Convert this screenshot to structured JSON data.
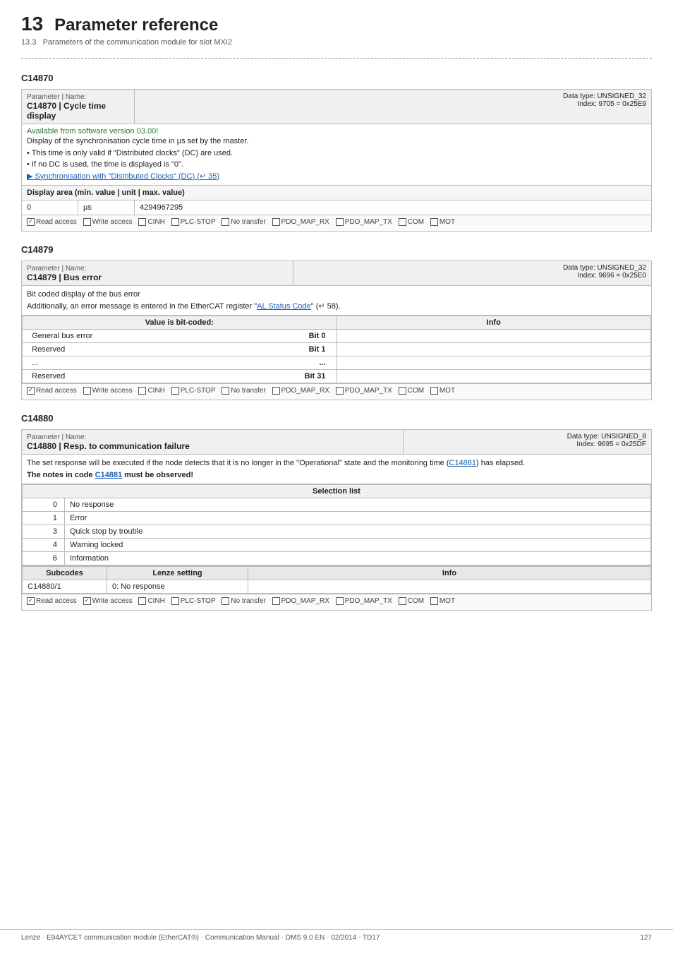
{
  "header": {
    "page_number": "13",
    "title": "Parameter reference",
    "sub_heading_number": "13.3",
    "sub_heading": "Parameters of the communication module for slot MXI2"
  },
  "divider": "_ _ _ _ _ _ _ _ _ _ _ _ _ _ _ _ _ _ _ _ _ _ _ _ _ _ _ _ _ _ _ _ _ _ _ _ _ _ _ _ _ _ _ _ _ _ _ _ _ _ _ _ _ _ _ _ _ _ _",
  "sections": [
    {
      "id": "C14870",
      "label": "C14870",
      "param_name": "C14870 | Cycle time display",
      "data_type": "Data type: UNSIGNED_32",
      "index": "Index: 9705 = 0x25E9",
      "available_note": "Available from software version 03.00!",
      "description_lines": [
        "Display of the synchronisation cycle time in µs set by the master.",
        "• This time is only valid if \"Distributed clocks\" (DC) are used.",
        "• If no DC is used, the time is displayed is \"0\".",
        "▶ Synchronisation with \"Distributed Clocks\" (DC) (↵ 35)"
      ],
      "display_area_label": "Display area (min. value | unit | max. value)",
      "display_area_min": "0",
      "display_area_unit": "µs",
      "display_area_max": "4294967295",
      "access": {
        "read_access": {
          "label": "Read access",
          "checked": true
        },
        "write_access": {
          "label": "Write access",
          "checked": false
        },
        "cinh": {
          "label": "CINH",
          "checked": false
        },
        "plc_stop": {
          "label": "PLC-STOP",
          "checked": false
        },
        "no_transfer": {
          "label": "No transfer",
          "checked": false
        },
        "pdo_map_rx": {
          "label": "PDO_MAP_RX",
          "checked": false
        },
        "pdo_map_tx": {
          "label": "PDO_MAP_TX",
          "checked": false
        },
        "com": {
          "label": "COM",
          "checked": false
        },
        "mot": {
          "label": "MOT",
          "checked": false
        }
      }
    },
    {
      "id": "C14879",
      "label": "C14879",
      "param_name": "C14879 | Bus error",
      "data_type": "Data type: UNSIGNED_32",
      "index": "Index: 9696 = 0x25E0",
      "description_lines": [
        "Bit coded display of the bus error",
        "Additionally, an error message is entered in the EtherCAT register \"AL Status Code\" (↵ 58)."
      ],
      "bit_coded_label": "Value is bit-coded:",
      "bit_info_label": "Info",
      "bits": [
        {
          "bit": "Bit 0",
          "desc": "General bus error",
          "info": ""
        },
        {
          "bit": "Bit 1",
          "desc": "Reserved",
          "info": ""
        },
        {
          "bit": "...",
          "desc": "...",
          "info": ""
        },
        {
          "bit": "Bit 31",
          "desc": "Reserved",
          "info": ""
        }
      ],
      "access": {
        "read_access": {
          "label": "Read access",
          "checked": true
        },
        "write_access": {
          "label": "Write access",
          "checked": false
        },
        "cinh": {
          "label": "CINH",
          "checked": false
        },
        "plc_stop": {
          "label": "PLC-STOP",
          "checked": false
        },
        "no_transfer": {
          "label": "No transfer",
          "checked": false
        },
        "pdo_map_rx": {
          "label": "PDO_MAP_RX",
          "checked": false
        },
        "pdo_map_tx": {
          "label": "PDO_MAP_TX",
          "checked": false
        },
        "com": {
          "label": "COM",
          "checked": false
        },
        "mot": {
          "label": "MOT",
          "checked": false
        }
      }
    },
    {
      "id": "C14880",
      "label": "C14880",
      "param_name": "C14880 | Resp. to communication failure",
      "data_type": "Data type: UNSIGNED_8",
      "index": "Index: 9695 = 0x25DF",
      "description_lines": [
        "The set response will be executed if the node detects that it is no longer in the \"Operational\" state and the monitoring time (C14881) has elapsed.",
        "The notes in code C14881 must be observed!"
      ],
      "selection_label": "Selection list",
      "selections": [
        {
          "value": "0",
          "desc": "No response"
        },
        {
          "value": "1",
          "desc": "Error"
        },
        {
          "value": "3",
          "desc": "Quick stop by trouble"
        },
        {
          "value": "4",
          "desc": "Warning locked"
        },
        {
          "value": "6",
          "desc": "Information"
        }
      ],
      "subcodes_header_subcode": "Subcodes",
      "subcodes_header_lenze": "Lenze setting",
      "subcodes_header_info": "Info",
      "subcodes": [
        {
          "subcode": "C14880/1",
          "lenze": "0: No response",
          "info": ""
        }
      ],
      "access": {
        "read_access": {
          "label": "Read access",
          "checked": true
        },
        "write_access": {
          "label": "Write access",
          "checked": true
        },
        "cinh": {
          "label": "CINH",
          "checked": false
        },
        "plc_stop": {
          "label": "PLC-STOP",
          "checked": false
        },
        "no_transfer": {
          "label": "No transfer",
          "checked": false
        },
        "pdo_map_rx": {
          "label": "PDO_MAP_RX",
          "checked": false
        },
        "pdo_map_tx": {
          "label": "PDO_MAP_TX",
          "checked": false
        },
        "com": {
          "label": "COM",
          "checked": false
        },
        "mot": {
          "label": "MOT",
          "checked": false
        }
      }
    }
  ],
  "footer": {
    "left": "Lenze · E94AYCET communication module (EtherCAT®) · Communication Manual · DMS 9.0 EN · 02/2014 · TD17",
    "right": "127"
  }
}
